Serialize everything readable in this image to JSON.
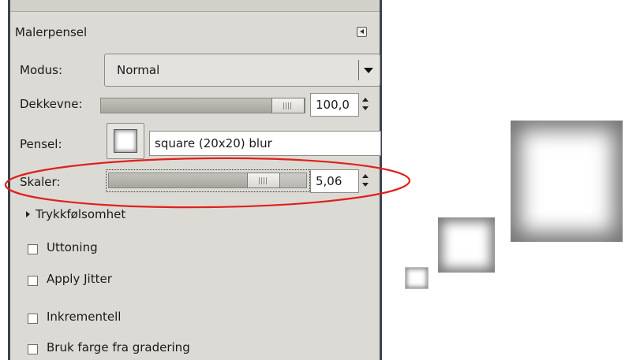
{
  "panel": {
    "title": "Malerpensel",
    "tab_menu_icon": "triangle-left-icon"
  },
  "mode": {
    "label": "Modus:",
    "value": "Normal"
  },
  "opacity": {
    "label": "Dekkevne:",
    "value": "100,0",
    "level_percent": 100
  },
  "brush": {
    "label": "Pensel:",
    "name": "square (20x20) blur"
  },
  "scale": {
    "label": "Skaler:",
    "value": "5,06",
    "level_fraction": 0.83
  },
  "pressure": {
    "label": "Trykkfølsomhet"
  },
  "options": [
    {
      "label": "Uttoning",
      "checked": false
    },
    {
      "label": "Apply Jitter",
      "checked": false
    },
    {
      "label": "Inkrementell",
      "checked": false
    },
    {
      "label": "Bruk farge fra gradering",
      "checked": false
    }
  ],
  "colors": {
    "panel_bg": "#dcdad5",
    "dock_border": "#3c4250",
    "highlight_ellipse": "#e0201a"
  }
}
